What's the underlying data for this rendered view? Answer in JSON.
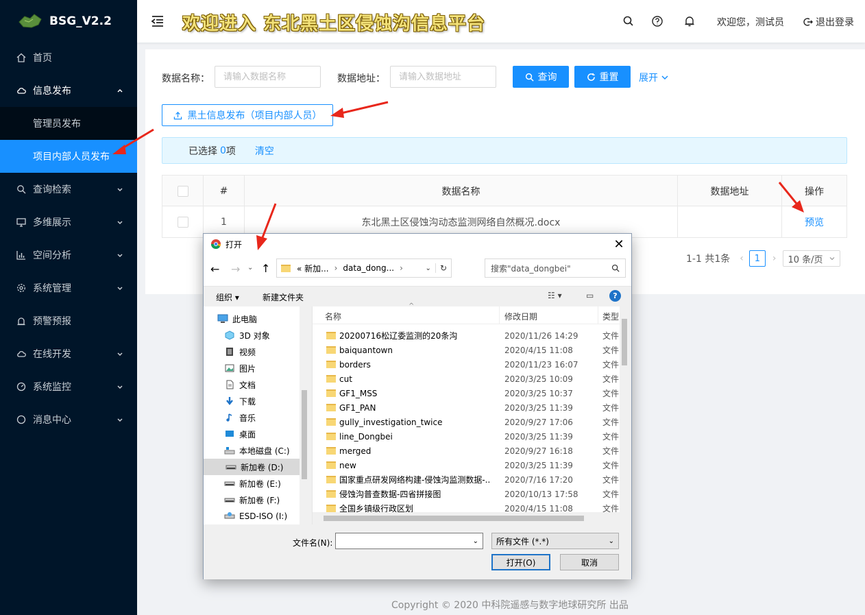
{
  "app": {
    "name": "BSG_V2.2",
    "title": "欢迎进入 东北黑土区侵蚀沟信息平台"
  },
  "header": {
    "welcome": "欢迎您，测试员",
    "logout": "退出登录"
  },
  "sidebar": {
    "items": [
      {
        "label": "首页"
      },
      {
        "label": "信息发布"
      },
      {
        "label": "管理员发布"
      },
      {
        "label": "项目内部人员发布"
      },
      {
        "label": "查询检索"
      },
      {
        "label": "多维展示"
      },
      {
        "label": "空间分析"
      },
      {
        "label": "系统管理"
      },
      {
        "label": "预警预报"
      },
      {
        "label": "在线开发"
      },
      {
        "label": "系统监控"
      },
      {
        "label": "消息中心"
      }
    ]
  },
  "search": {
    "name_label": "数据名称：",
    "name_placeholder": "请输入数据名称",
    "addr_label": "数据地址：",
    "addr_placeholder": "请输入数据地址",
    "query": "查询",
    "reset": "重置",
    "expand": "展开"
  },
  "upload_label": "黑土信息发布（项目内部人员）",
  "selection": {
    "prefix": "已选择",
    "count": "0",
    "suffix": "项",
    "clear": "清空"
  },
  "table": {
    "headers": [
      "#",
      "数据名称",
      "数据地址",
      "操作"
    ],
    "rows": [
      {
        "index": "1",
        "name": "东北黑土区侵蚀沟动态监测网络自然概况.docx",
        "addr": "",
        "action": "预览"
      }
    ]
  },
  "pagination": {
    "summary": "1-1 共1条",
    "current": "1",
    "page_size": "10 条/页"
  },
  "footer": "Copyright © 2020 中科院遥感与数字地球研究所 出品",
  "dialog": {
    "title": "打开",
    "path": [
      "« 新加...",
      "data_dong..."
    ],
    "search_placeholder": "搜索\"data_dongbei\"",
    "organize": "组织",
    "new_folder": "新建文件夹",
    "columns": [
      "名称",
      "修改日期",
      "类型"
    ],
    "nav": [
      "此电脑",
      "3D 对象",
      "视频",
      "图片",
      "文档",
      "下载",
      "音乐",
      "桌面",
      "本地磁盘 (C:)",
      "新加卷 (D:)",
      "新加卷 (E:)",
      "新加卷 (F:)",
      "ESD-ISO (I:)"
    ],
    "files": [
      {
        "name": "20200716松辽委监测的20条沟",
        "date": "2020/11/26 14:29",
        "type": "文件"
      },
      {
        "name": "baiquantown",
        "date": "2020/4/15 11:08",
        "type": "文件"
      },
      {
        "name": "borders",
        "date": "2020/11/23 16:07",
        "type": "文件"
      },
      {
        "name": "cut",
        "date": "2020/3/25 10:09",
        "type": "文件"
      },
      {
        "name": "GF1_MSS",
        "date": "2020/3/25 10:37",
        "type": "文件"
      },
      {
        "name": "GF1_PAN",
        "date": "2020/3/25 11:39",
        "type": "文件"
      },
      {
        "name": "gully_investigation_twice",
        "date": "2020/9/27 17:06",
        "type": "文件"
      },
      {
        "name": "line_Dongbei",
        "date": "2020/3/25 11:39",
        "type": "文件"
      },
      {
        "name": "merged",
        "date": "2020/9/27 16:18",
        "type": "文件"
      },
      {
        "name": "new",
        "date": "2020/3/25 11:39",
        "type": "文件"
      },
      {
        "name": "国家重点研发网络构建-侵蚀沟监测数据-...",
        "date": "2020/7/16 17:20",
        "type": "文件"
      },
      {
        "name": "侵蚀沟普查数据-四省拼接图",
        "date": "2020/10/13 17:58",
        "type": "文件"
      },
      {
        "name": "全国乡镇级行政区划",
        "date": "2020/4/15 11:08",
        "type": "文件"
      }
    ],
    "filename_label": "文件名(N):",
    "filename_value": "",
    "filter": "所有文件 (*.*)",
    "open": "打开(O)",
    "cancel": "取消"
  }
}
